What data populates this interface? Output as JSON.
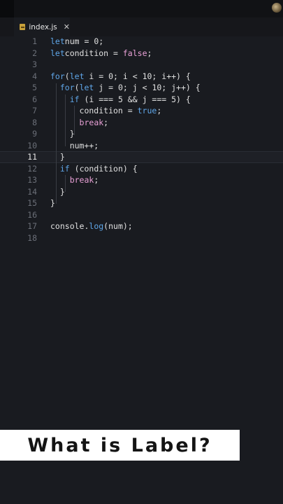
{
  "tab": {
    "filename": "index.js",
    "icon": "js-file-icon",
    "close_glyph": "✕"
  },
  "editor": {
    "current_line": 11,
    "lines": [
      {
        "n": "1",
        "tokens": [
          [
            "kw",
            "let"
          ],
          [
            "",
            "num = 0;"
          ]
        ]
      },
      {
        "n": "2",
        "tokens": [
          [
            "kw",
            "let"
          ],
          [
            "",
            "condition = "
          ],
          [
            "fl",
            "false"
          ],
          [
            "",
            ";"
          ]
        ]
      },
      {
        "n": "3",
        "tokens": []
      },
      {
        "n": "4",
        "tokens": [
          [
            "kw",
            "for"
          ],
          [
            "",
            "("
          ],
          [
            "kw",
            "let"
          ],
          [
            "",
            " i = 0; i < 10; i++) {"
          ]
        ]
      },
      {
        "n": "5",
        "tokens": [
          [
            "",
            "  "
          ],
          [
            "kw",
            "for"
          ],
          [
            "",
            "("
          ],
          [
            "kw",
            "let"
          ],
          [
            "",
            " j = 0; j < 10; j++) {"
          ]
        ]
      },
      {
        "n": "6",
        "tokens": [
          [
            "",
            "    "
          ],
          [
            "kw",
            "if"
          ],
          [
            "",
            " (i === 5 && j === 5) {"
          ]
        ]
      },
      {
        "n": "7",
        "tokens": [
          [
            "",
            "      condition = "
          ],
          [
            "kw",
            "true"
          ],
          [
            "",
            ";"
          ]
        ]
      },
      {
        "n": "8",
        "tokens": [
          [
            "",
            "      "
          ],
          [
            "fl",
            "break"
          ],
          [
            "",
            ";"
          ]
        ]
      },
      {
        "n": "9",
        "tokens": [
          [
            "",
            "    }"
          ]
        ]
      },
      {
        "n": "10",
        "tokens": [
          [
            "",
            "    num++;"
          ]
        ]
      },
      {
        "n": "11",
        "tokens": [
          [
            "",
            "  }"
          ]
        ]
      },
      {
        "n": "12",
        "tokens": [
          [
            "",
            "  "
          ],
          [
            "kw",
            "if"
          ],
          [
            "",
            " (condition) {"
          ]
        ]
      },
      {
        "n": "13",
        "tokens": [
          [
            "",
            "    "
          ],
          [
            "fl",
            "break"
          ],
          [
            "",
            ";"
          ]
        ]
      },
      {
        "n": "14",
        "tokens": [
          [
            "",
            "  }"
          ]
        ]
      },
      {
        "n": "15",
        "tokens": [
          [
            "",
            "}"
          ]
        ]
      },
      {
        "n": "16",
        "tokens": []
      },
      {
        "n": "17",
        "tokens": [
          [
            "",
            "console."
          ],
          [
            "kw",
            "log"
          ],
          [
            "",
            "(num);"
          ]
        ]
      },
      {
        "n": "18",
        "tokens": []
      }
    ]
  },
  "caption": {
    "text": "What is Label?"
  },
  "colors": {
    "background": "#191b20",
    "keyword": "#5fa6e8",
    "flow": "#e8a0d6",
    "text": "#e0e0e0"
  }
}
